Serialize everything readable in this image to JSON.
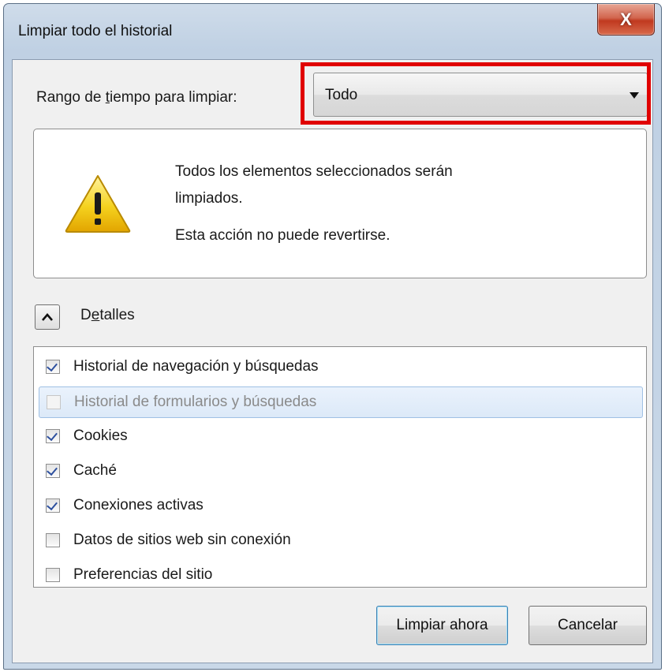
{
  "window": {
    "title": "Limpiar todo el historial",
    "close_glyph": "X"
  },
  "time_range": {
    "label_pre": "Rango de ",
    "label_accel": "t",
    "label_post": "iempo para limpiar:",
    "selected": "Todo"
  },
  "warning": {
    "icon": "warning-icon",
    "line1": "Todos los elementos seleccionados serán",
    "line2": "limpiados.",
    "line3": "Esta acción no puede revertirse."
  },
  "details": {
    "label_pre": "D",
    "label_accel": "e",
    "label_post": "talles",
    "expanded": true
  },
  "items": [
    {
      "label": "Historial de navegación y búsquedas",
      "checked": true,
      "enabled": true
    },
    {
      "label": "Historial de formularios y búsquedas",
      "checked": false,
      "enabled": false,
      "selected": true
    },
    {
      "label": "Cookies",
      "checked": true,
      "enabled": true
    },
    {
      "label": "Caché",
      "checked": true,
      "enabled": true
    },
    {
      "label": "Conexiones activas",
      "checked": true,
      "enabled": true
    },
    {
      "label": "Datos de sitios web sin conexión",
      "checked": false,
      "enabled": true
    },
    {
      "label": "Preferencias del sitio",
      "checked": false,
      "enabled": true
    }
  ],
  "buttons": {
    "clear_now": "Limpiar ahora",
    "cancel": "Cancelar"
  },
  "colors": {
    "highlight": "#e00000"
  }
}
